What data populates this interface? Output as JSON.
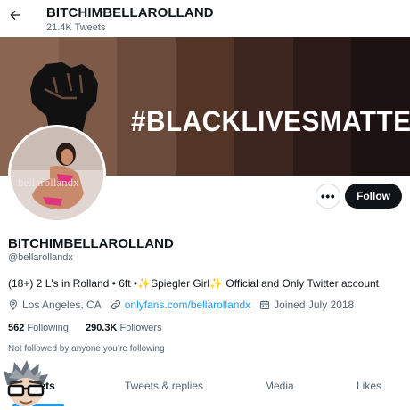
{
  "header": {
    "title": "BITCHIMBELLAROLLAND",
    "tweet_count": "21.4K Tweets",
    "back_icon": "arrow-left-icon"
  },
  "banner": {
    "hashtag": "#BLACKLIVESMATTER",
    "fist_icon": "raised-fist-icon",
    "stripe_colors": [
      "#8a6551",
      "#7d5a47",
      "#6a4a3a",
      "#533528",
      "#3e2620",
      "#2b1a17",
      "#1c1212"
    ]
  },
  "avatar": {
    "watermark": "bellarollandx"
  },
  "actions": {
    "more_label": "•••",
    "follow_label": "Follow"
  },
  "profile": {
    "name": "BITCHIMBELLAROLLAND",
    "handle": "@bellarollandx",
    "bio_part1": "(18+) 2 L's in Rolland • 6ft •",
    "bio_sparkle1": "✨",
    "bio_part2": "Spiegler Girl",
    "bio_sparkle2": "✨",
    "bio_part3": " Official and Only Twitter account",
    "location": "Los Angeles, CA",
    "link": "onlyfans.com/bellarollandx",
    "joined": "Joined July 2018",
    "following_count": "562",
    "following_label": "Following",
    "followers_count": "290.3K",
    "followers_label": "Followers",
    "not_followed": "Not followed by anyone you’re following"
  },
  "tabs": {
    "tweets": "Tweets",
    "replies": "Tweets & replies",
    "media": "Media",
    "likes": "Likes"
  },
  "colors": {
    "accent": "#1d9bf0",
    "text": "#0f1419",
    "muted": "#536471"
  }
}
